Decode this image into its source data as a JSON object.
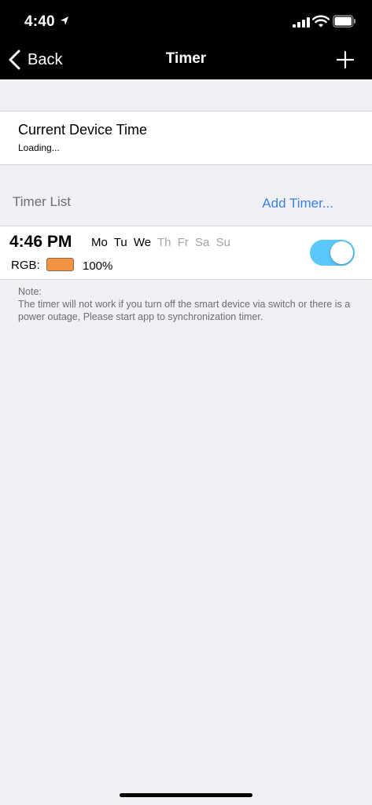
{
  "status_bar": {
    "time": "4:40",
    "icons": [
      "location-arrow-icon",
      "cellular-signal-icon",
      "wifi-icon",
      "battery-icon"
    ]
  },
  "nav": {
    "back_label": "Back",
    "title": "Timer",
    "add_icon": "plus-icon"
  },
  "device_time": {
    "title": "Current Device Time",
    "value": "Loading..."
  },
  "timer_list": {
    "label": "Timer List",
    "add_timer_label": "Add Timer...",
    "items": [
      {
        "time": "4:46 PM",
        "days": [
          {
            "label": "Mo",
            "active": true
          },
          {
            "label": "Tu",
            "active": true
          },
          {
            "label": "We",
            "active": true
          },
          {
            "label": "Th",
            "active": false
          },
          {
            "label": "Fr",
            "active": false
          },
          {
            "label": "Sa",
            "active": false
          },
          {
            "label": "Su",
            "active": false
          }
        ],
        "mode_label": "RGB:",
        "color": "#f39442",
        "brightness": "100%",
        "enabled": true
      }
    ]
  },
  "note": {
    "title": "Note:",
    "text": "The timer will not work if you turn off the smart device via switch or there is a power outage, Please start app to synchronization timer."
  },
  "colors": {
    "toggle_on": "#5ac8fa",
    "link": "#3b82e0",
    "background": "#efeff4"
  }
}
